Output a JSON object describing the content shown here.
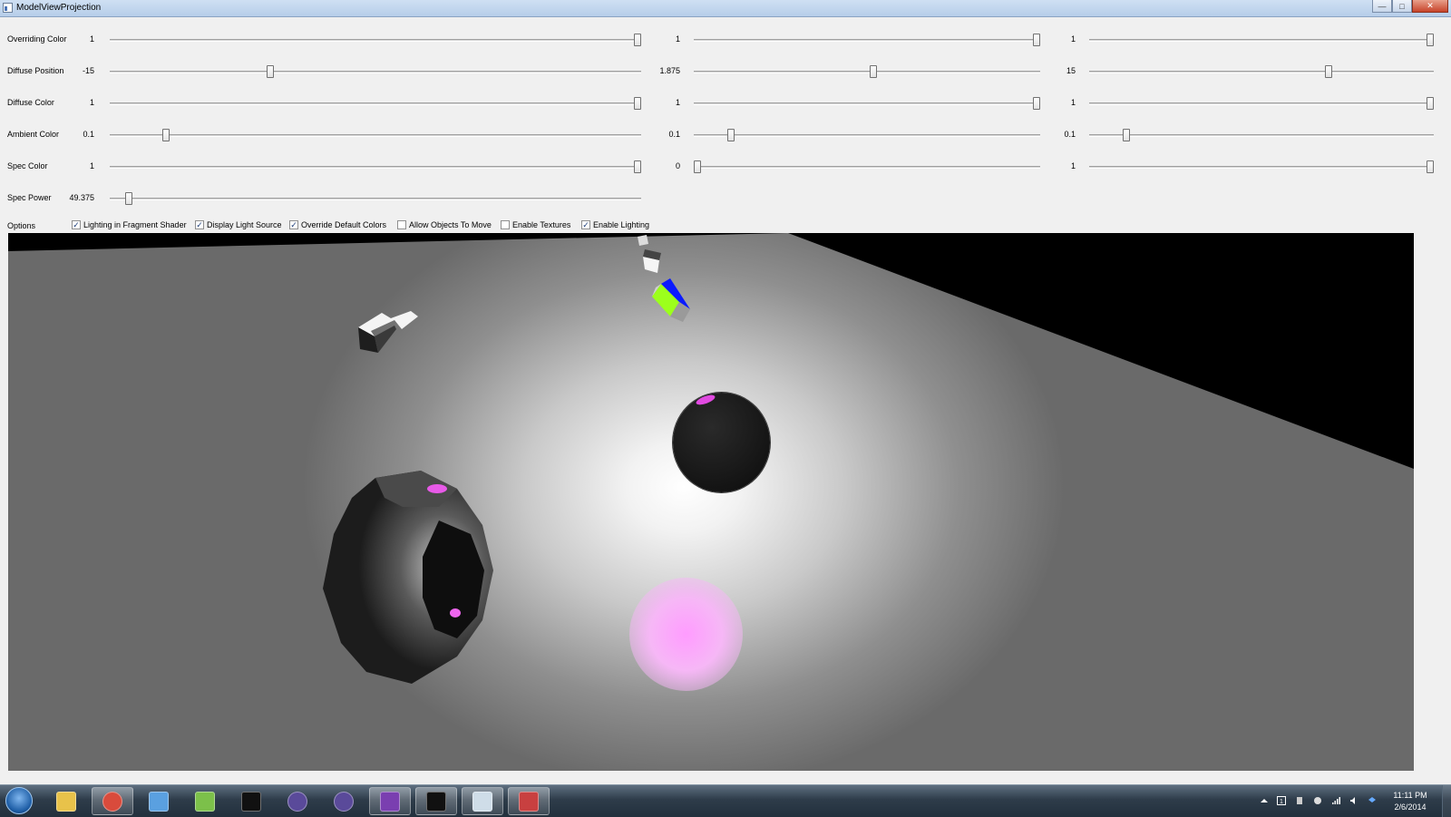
{
  "window": {
    "title": "ModelViewProjection"
  },
  "sliders": [
    {
      "label": "Overriding Color",
      "values": [
        "1",
        "1",
        "1"
      ],
      "positions": [
        1.0,
        1.0,
        1.0
      ]
    },
    {
      "label": "Diffuse Position",
      "values": [
        "-15",
        "1.875",
        "15"
      ],
      "positions": [
        0.3,
        0.52,
        0.7
      ]
    },
    {
      "label": "Diffuse Color",
      "values": [
        "1",
        "1",
        "1"
      ],
      "positions": [
        1.0,
        1.0,
        1.0
      ]
    },
    {
      "label": "Ambient Color",
      "values": [
        "0.1",
        "0.1",
        "0.1"
      ],
      "positions": [
        0.1,
        0.1,
        0.1
      ]
    },
    {
      "label": "Spec Color",
      "values": [
        "1",
        "0",
        "1"
      ],
      "positions": [
        1.0,
        0.0,
        1.0
      ]
    },
    {
      "label": "Spec Power",
      "values": [
        "49.375"
      ],
      "positions": [
        0.03
      ]
    }
  ],
  "options": {
    "label": "Options",
    "items": [
      {
        "label": "Lighting in Fragment Shader",
        "checked": true
      },
      {
        "label": "Display Light Source",
        "checked": true
      },
      {
        "label": "Override Default Colors",
        "checked": true
      },
      {
        "label": "Allow Objects To Move",
        "checked": false
      },
      {
        "label": "Enable Textures",
        "checked": false
      },
      {
        "label": "Enable Lighting",
        "checked": true
      }
    ]
  },
  "taskbar": {
    "apps": [
      "file-explorer-icon",
      "chrome-icon",
      "notepad-icon",
      "task-manager-icon",
      "command-prompt-icon",
      "eclipse-icon",
      "eclipse-icon",
      "visual-studio-icon",
      "command-prompt-icon",
      "window-icon",
      "opengl-app-icon"
    ],
    "time": "11:11 PM",
    "date": "2/6/2014"
  }
}
